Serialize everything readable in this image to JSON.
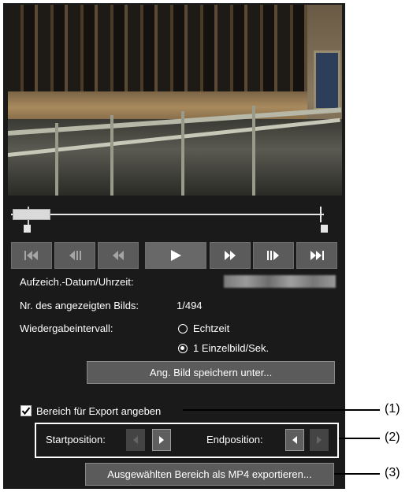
{
  "transport": {
    "icons": [
      "skip-start-icon",
      "step-back-icon",
      "rewind-icon",
      "play-icon",
      "fast-forward-icon",
      "step-forward-icon",
      "skip-end-icon"
    ]
  },
  "info": {
    "record_datetime_label": "Aufzeich.-Datum/Uhrzeit:",
    "frame_number_label": "Nr. des angezeigten Bilds:",
    "frame_number_value": "1/494",
    "playback_interval_label": "Wiedergabeintervall:",
    "options": [
      "Echtzeit",
      "1 Einzelbild/Sek."
    ],
    "selected_option": "1 Einzelbild/Sek."
  },
  "buttons": {
    "save_image": "Ang. Bild speichern unter...",
    "export_mp4": "Ausgewählten Bereich als MP4 exportieren..."
  },
  "export": {
    "checkbox_label": "Bereich für Export angeben",
    "checked": true,
    "start_label": "Startposition:",
    "end_label": "Endposition:"
  },
  "callouts": [
    "(1)",
    "(2)",
    "(3)"
  ],
  "colors": {
    "panel_bg": "#1a1a1a",
    "button_bg": "#5b5b5b",
    "text": "#ffffff"
  }
}
